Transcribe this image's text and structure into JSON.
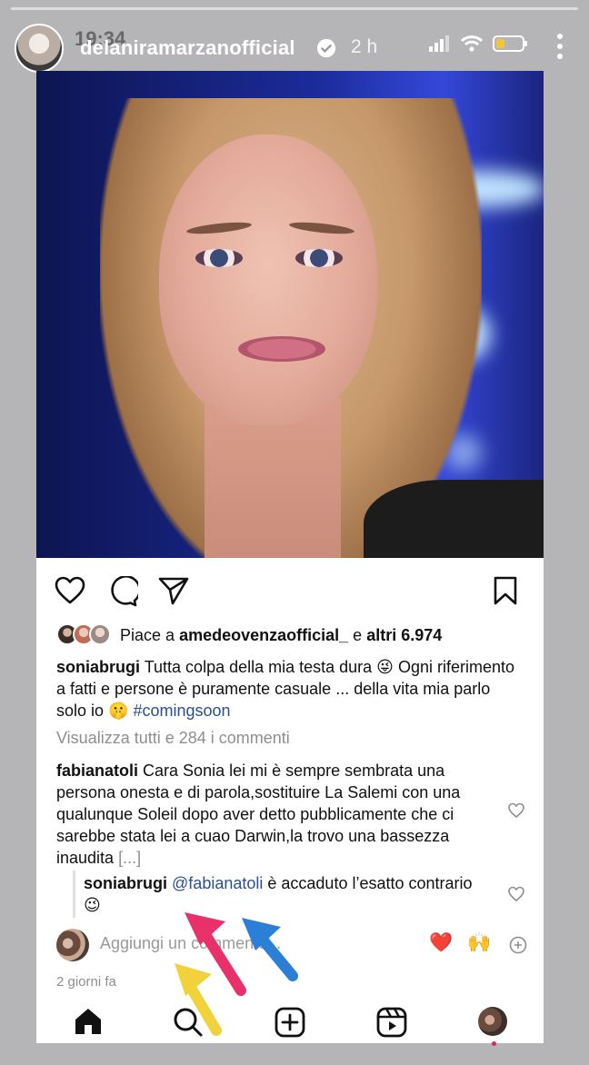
{
  "story": {
    "time": "19:34",
    "username": "delaniramarzanofficial",
    "age": "2 h"
  },
  "post": {
    "likes": {
      "prefix": "Piace a",
      "user": "amedeovenzaofficial_",
      "middle": "e",
      "others": "altri 6.974"
    },
    "caption": {
      "author": "soniabrugi",
      "text": "Tutta colpa della mia testa dura 😜 Ogni riferimento a fatti e persone è puramente casuale ... della vita mia parlo solo io 🤫",
      "hashtag": "#comingsoon"
    },
    "view_comments": "Visualizza tutti e 284 i commenti",
    "comment": {
      "author": "fabianatoli",
      "text": "Cara Sonia lei mi è sempre sembrata una persona onesta e di parola,sostituire La Salemi con una qualunque Soleil dopo aver detto pubblicamente che ci sarebbe stata lei a cuao Darwin,la trovo una bassezza inaudita",
      "more": "[...]"
    },
    "reply": {
      "author": "soniabrugi",
      "mention": "@fabianatoli",
      "text": "è accaduto l’esatto contrario 😉"
    },
    "add_comment_placeholder": "Aggiungi un commento...",
    "quick_reactions": [
      "❤️",
      "🙌"
    ],
    "post_age": "2 giorni fa"
  },
  "icons": {
    "like": "heart-icon",
    "comment": "comment-icon",
    "share": "send-icon",
    "save": "bookmark-icon",
    "home": "home-icon",
    "search": "search-icon",
    "create": "add-post-icon",
    "reels": "reels-icon"
  },
  "annotation_arrow_colors": [
    "#e8306a",
    "#2c7fd6",
    "#f2d23a"
  ]
}
